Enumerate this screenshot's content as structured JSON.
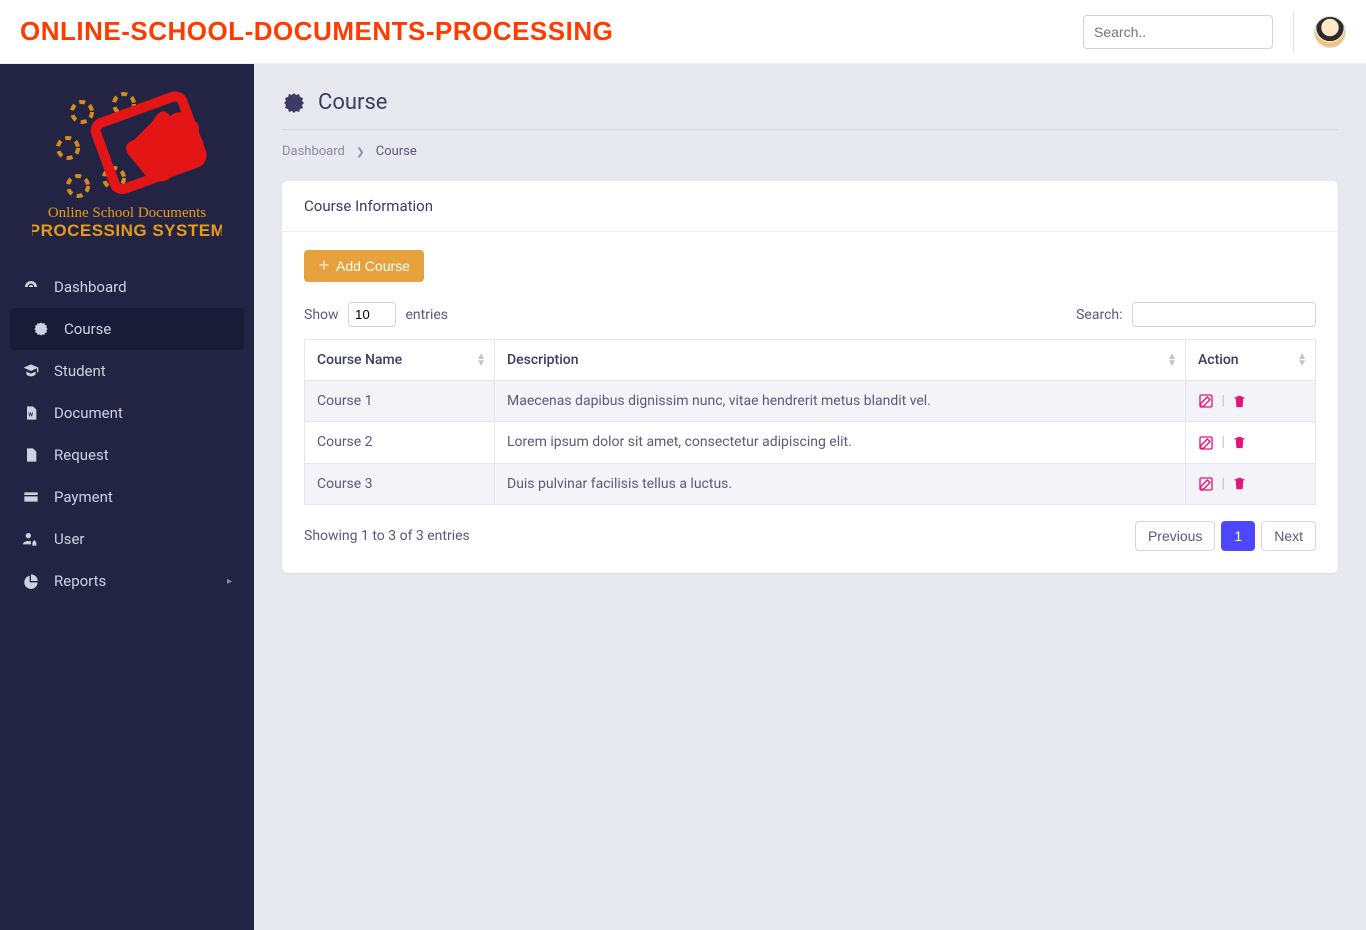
{
  "header": {
    "brand": "ONLINE-SCHOOL-DOCUMENTS-PROCESSING",
    "search_placeholder": "Search.."
  },
  "sidebar": {
    "logo_line1": "Online School Documents",
    "logo_line2": "PROCESSING SYSTEM",
    "items": [
      {
        "label": "Dashboard",
        "icon": "gauge-icon"
      },
      {
        "label": "Course",
        "icon": "certificate-icon",
        "active": true
      },
      {
        "label": "Student",
        "icon": "graduate-icon"
      },
      {
        "label": "Document",
        "icon": "file-word-icon"
      },
      {
        "label": "Request",
        "icon": "file-icon"
      },
      {
        "label": "Payment",
        "icon": "card-icon"
      },
      {
        "label": "User",
        "icon": "users-lock-icon"
      },
      {
        "label": "Reports",
        "icon": "pie-icon",
        "expandable": true
      }
    ]
  },
  "page": {
    "title": "Course",
    "breadcrumb": {
      "root": "Dashboard",
      "current": "Course"
    }
  },
  "panel": {
    "title": "Course Information",
    "add_label": "Add Course",
    "length": {
      "show": "Show",
      "entries": "entries",
      "value": "10"
    },
    "search_label": "Search:",
    "columns": {
      "c0": "Course Name",
      "c1": "Description",
      "c2": "Action"
    },
    "rows": [
      {
        "name": "Course 1",
        "desc": "Maecenas dapibus dignissim nunc, vitae hendrerit metus blandit vel."
      },
      {
        "name": "Course 2",
        "desc": "Lorem ipsum dolor sit amet, consectetur adipiscing elit."
      },
      {
        "name": "Course 3",
        "desc": "Duis pulvinar facilisis tellus a luctus."
      }
    ],
    "info": "Showing 1 to 3 of 3 entries",
    "pagination": {
      "prev": "Previous",
      "page": "1",
      "next": "Next"
    }
  }
}
